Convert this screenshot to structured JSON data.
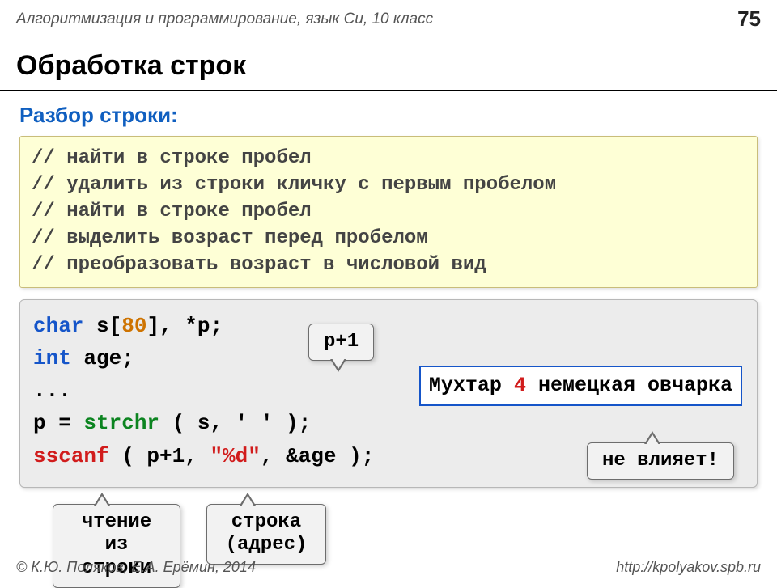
{
  "header": {
    "course": "Алгоритмизация и программирование, язык Си, 10 класс",
    "page": "75"
  },
  "title": "Обработка строк",
  "subtitle": "Разбор строки:",
  "comments": [
    "// найти в строке пробел",
    "// удалить из строки кличку с первым пробелом",
    "// найти в строке пробел",
    "// выделить возраст перед пробелом",
    "// преобразовать возраст в числовой вид"
  ],
  "code": {
    "l1_kw": "char",
    "l1_rest1": " s[",
    "l1_num": "80",
    "l1_rest2": "], *p;",
    "l2_kw": "int",
    "l2_rest": " age;",
    "l3": "...",
    "l4_pre": "p = ",
    "l4_fn": "strchr",
    "l4_post": " ( s, ' ' );",
    "l5_fn": "sscanf",
    "l5_mid": " ( p+1, ",
    "l5_str": "\"%d\"",
    "l5_end": ", &age );"
  },
  "sample": {
    "prefix": "Мухтар ",
    "accent": "4",
    "suffix": " немецкая овчарка"
  },
  "bubbles": {
    "p1": "p+1",
    "nv": "не влияет!",
    "read1": "чтение из",
    "read2": "строки",
    "addr1": "строка",
    "addr2": "(адрес)"
  },
  "footer": {
    "left": "© К.Ю. Поляков, Е.А. Ерёмин, 2014",
    "right": "http://kpolyakov.spb.ru"
  }
}
